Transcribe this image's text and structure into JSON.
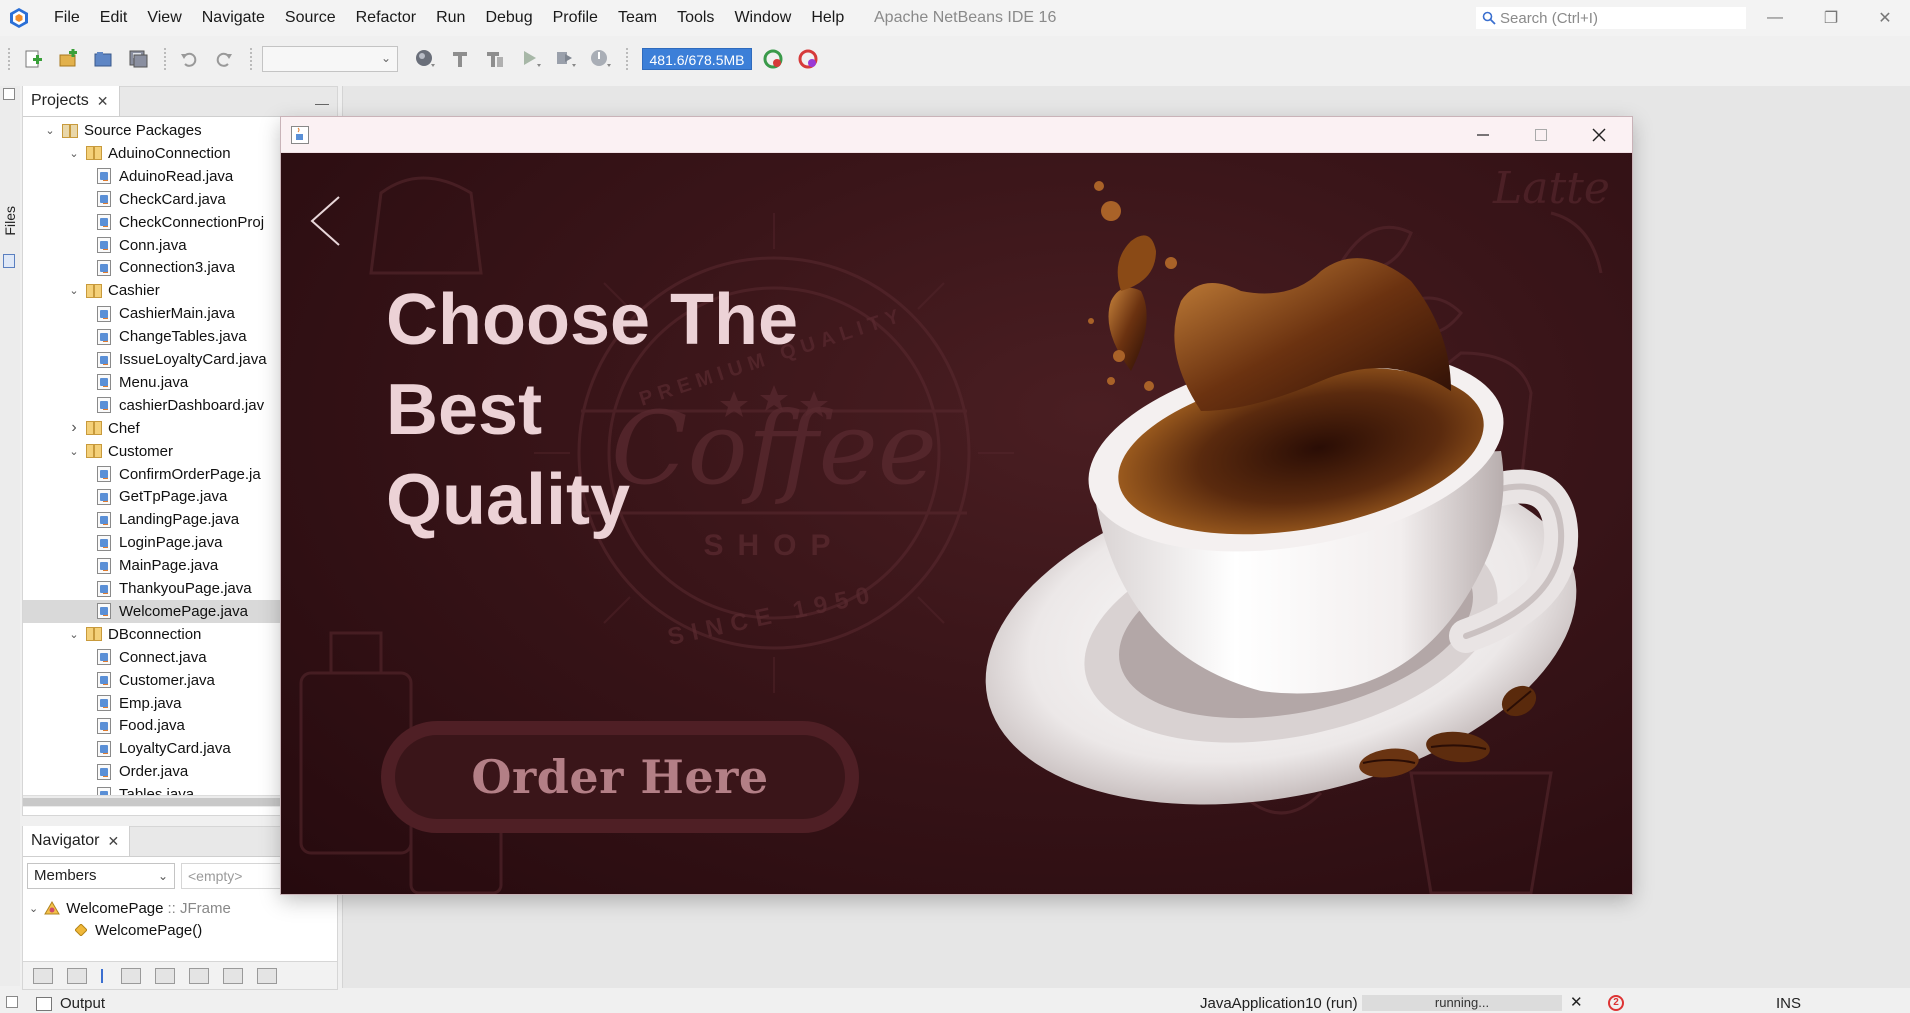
{
  "ide": {
    "title": "Apache NetBeans IDE 16",
    "menu": [
      "File",
      "Edit",
      "View",
      "Navigate",
      "Source",
      "Refactor",
      "Run",
      "Debug",
      "Profile",
      "Team",
      "Tools",
      "Window",
      "Help"
    ],
    "search_placeholder": "Search (Ctrl+I)",
    "memory": "481.6/678.5MB"
  },
  "projects": {
    "tab_label": "Projects",
    "files_tab": "Files",
    "tree": [
      {
        "label": "Source Packages",
        "kind": "pkg-root",
        "level": 0,
        "state": "expanded"
      },
      {
        "label": "AduinoConnection",
        "kind": "package",
        "level": 1,
        "state": "expanded"
      },
      {
        "label": "AduinoRead.java",
        "kind": "java",
        "level": 2
      },
      {
        "label": "CheckCard.java",
        "kind": "java",
        "level": 2
      },
      {
        "label": "CheckConnectionProj",
        "kind": "java",
        "level": 2
      },
      {
        "label": "Conn.java",
        "kind": "java",
        "level": 2
      },
      {
        "label": "Connection3.java",
        "kind": "java",
        "level": 2
      },
      {
        "label": "Cashier",
        "kind": "package",
        "level": 1,
        "state": "expanded"
      },
      {
        "label": "CashierMain.java",
        "kind": "java",
        "level": 2
      },
      {
        "label": "ChangeTables.java",
        "kind": "java",
        "level": 2
      },
      {
        "label": "IssueLoyaltyCard.java",
        "kind": "java",
        "level": 2
      },
      {
        "label": "Menu.java",
        "kind": "java",
        "level": 2
      },
      {
        "label": "cashierDashboard.jav",
        "kind": "java",
        "level": 2
      },
      {
        "label": "Chef",
        "kind": "package",
        "level": 1,
        "state": "collapsed"
      },
      {
        "label": "Customer",
        "kind": "package",
        "level": 1,
        "state": "expanded"
      },
      {
        "label": "ConfirmOrderPage.ja",
        "kind": "java",
        "level": 2
      },
      {
        "label": "GetTpPage.java",
        "kind": "java",
        "level": 2
      },
      {
        "label": "LandingPage.java",
        "kind": "java",
        "level": 2
      },
      {
        "label": "LoginPage.java",
        "kind": "java",
        "level": 2
      },
      {
        "label": "MainPage.java",
        "kind": "java",
        "level": 2
      },
      {
        "label": "ThankyouPage.java",
        "kind": "java",
        "level": 2
      },
      {
        "label": "WelcomePage.java",
        "kind": "java",
        "level": 2,
        "selected": true
      },
      {
        "label": "DBconnection",
        "kind": "package",
        "level": 1,
        "state": "expanded"
      },
      {
        "label": "Connect.java",
        "kind": "java",
        "level": 2
      },
      {
        "label": "Customer.java",
        "kind": "java",
        "level": 2
      },
      {
        "label": "Emp.java",
        "kind": "java",
        "level": 2
      },
      {
        "label": "Food.java",
        "kind": "java",
        "level": 2
      },
      {
        "label": "LoyaltyCard.java",
        "kind": "java",
        "level": 2
      },
      {
        "label": "Order.java",
        "kind": "java",
        "level": 2
      },
      {
        "label": "Tables.java",
        "kind": "java",
        "level": 2
      }
    ]
  },
  "navigator": {
    "tab_label": "Navigator",
    "members_combo": "Members",
    "filter_placeholder": "<empty>",
    "class_name": "WelcomePage",
    "class_type": ":: JFrame",
    "constructor": "WelcomePage()"
  },
  "status": {
    "output_label": "Output",
    "run_label": "JavaApplication10 (run)",
    "progress_text": "running...",
    "notifications": "2",
    "insert_mode": "INS"
  },
  "app_window": {
    "headline": [
      "Choose The",
      "Best",
      "Quality"
    ],
    "button_label": "Order Here",
    "background_color": "#2d0f13",
    "headline_color": "#ecd2d6",
    "button_text_color": "#b37f86",
    "emblem_top": "PREMIUM QUALITY",
    "emblem_mid": "Coffee",
    "emblem_shop": "SHOP",
    "emblem_since": "SINCE 1950",
    "bg_word": "Latte"
  }
}
